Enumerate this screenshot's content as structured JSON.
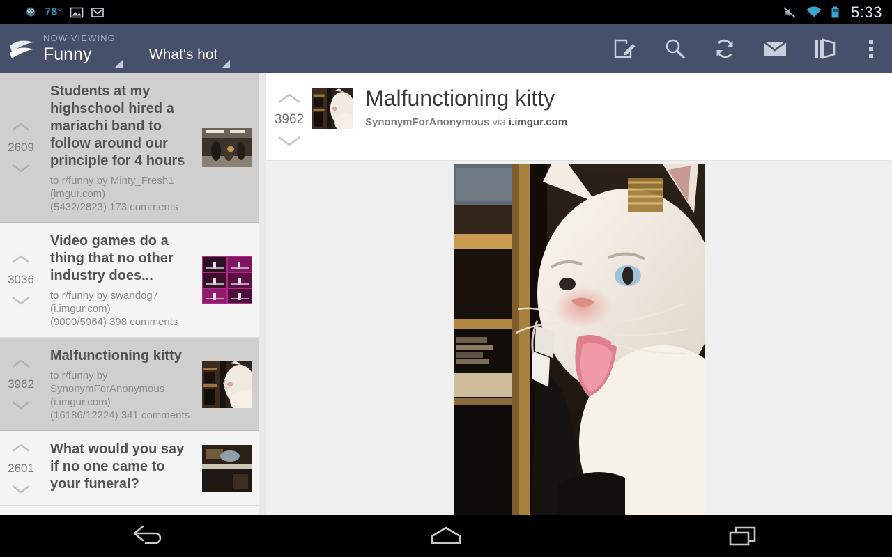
{
  "statusbar": {
    "temperature": "78°",
    "clock": "5:33",
    "icons": [
      "twitter-bird-icon",
      "gallery-icon",
      "gmail-icon",
      "mute-icon",
      "wifi-icon",
      "battery-icon"
    ]
  },
  "actionbar": {
    "logo": "reddit-app-logo-icon",
    "now_viewing_label": "NOW VIEWING",
    "subreddit": "Funny",
    "sort": "What's hot",
    "actions": [
      {
        "name": "compose-button",
        "icon": "compose-icon"
      },
      {
        "name": "search-button",
        "icon": "search-icon"
      },
      {
        "name": "refresh-button",
        "icon": "refresh-icon"
      },
      {
        "name": "messages-button",
        "icon": "mail-icon"
      },
      {
        "name": "saved-button",
        "icon": "book-icon"
      },
      {
        "name": "overflow-button",
        "icon": "overflow-menu-icon"
      }
    ]
  },
  "posts": [
    {
      "score": "2609",
      "title": "Students at my highschool hired a mariachi band to follow around our principle for 4 hours",
      "meta_line1": "to r/funny by Minty_Fresh1",
      "meta_line2": "(imgur.com)",
      "meta_line3": "(5432/2823) 173 comments",
      "thumbnail": "mariachi-band-thumbnail",
      "selected": true
    },
    {
      "score": "3036",
      "title": "Video games do a thing that no other industry does...",
      "meta_line1": "to r/funny by swandog7",
      "meta_line2": "(i.imgur.com)",
      "meta_line3": "(9000/5964) 398 comments",
      "thumbnail": "stage-grid-thumbnail",
      "selected": false
    },
    {
      "score": "3962",
      "title": "Malfunctioning kitty",
      "meta_line1": "to r/funny by",
      "meta_line2": "SynonymForAnonymous",
      "meta_line3": "(i.imgur.com)",
      "meta_line4": "(16186/12224) 341 comments",
      "thumbnail": "cat-thumbnail",
      "selected": true
    },
    {
      "score": "2601",
      "title": "What would you say if no one came to your funeral?",
      "meta_line1": "",
      "meta_line2": "",
      "meta_line3": "",
      "thumbnail": "funeral-thumbnail",
      "selected": false
    }
  ],
  "detail": {
    "score": "3962",
    "title": "Malfunctioning kitty",
    "author": "SynonymForAnonymous",
    "via_label": "via",
    "domain": "i.imgur.com",
    "thumbnail": "cat-thumbnail",
    "image": "malfunctioning-kitty-photo"
  },
  "navbar": {
    "back": "back-icon",
    "home": "home-icon",
    "recents": "recents-icon"
  },
  "colors": {
    "actionbar": "#47506a",
    "selected_row": "#cfcfcf",
    "row": "#f4f4f4",
    "status_accent": "#2f90b8"
  }
}
